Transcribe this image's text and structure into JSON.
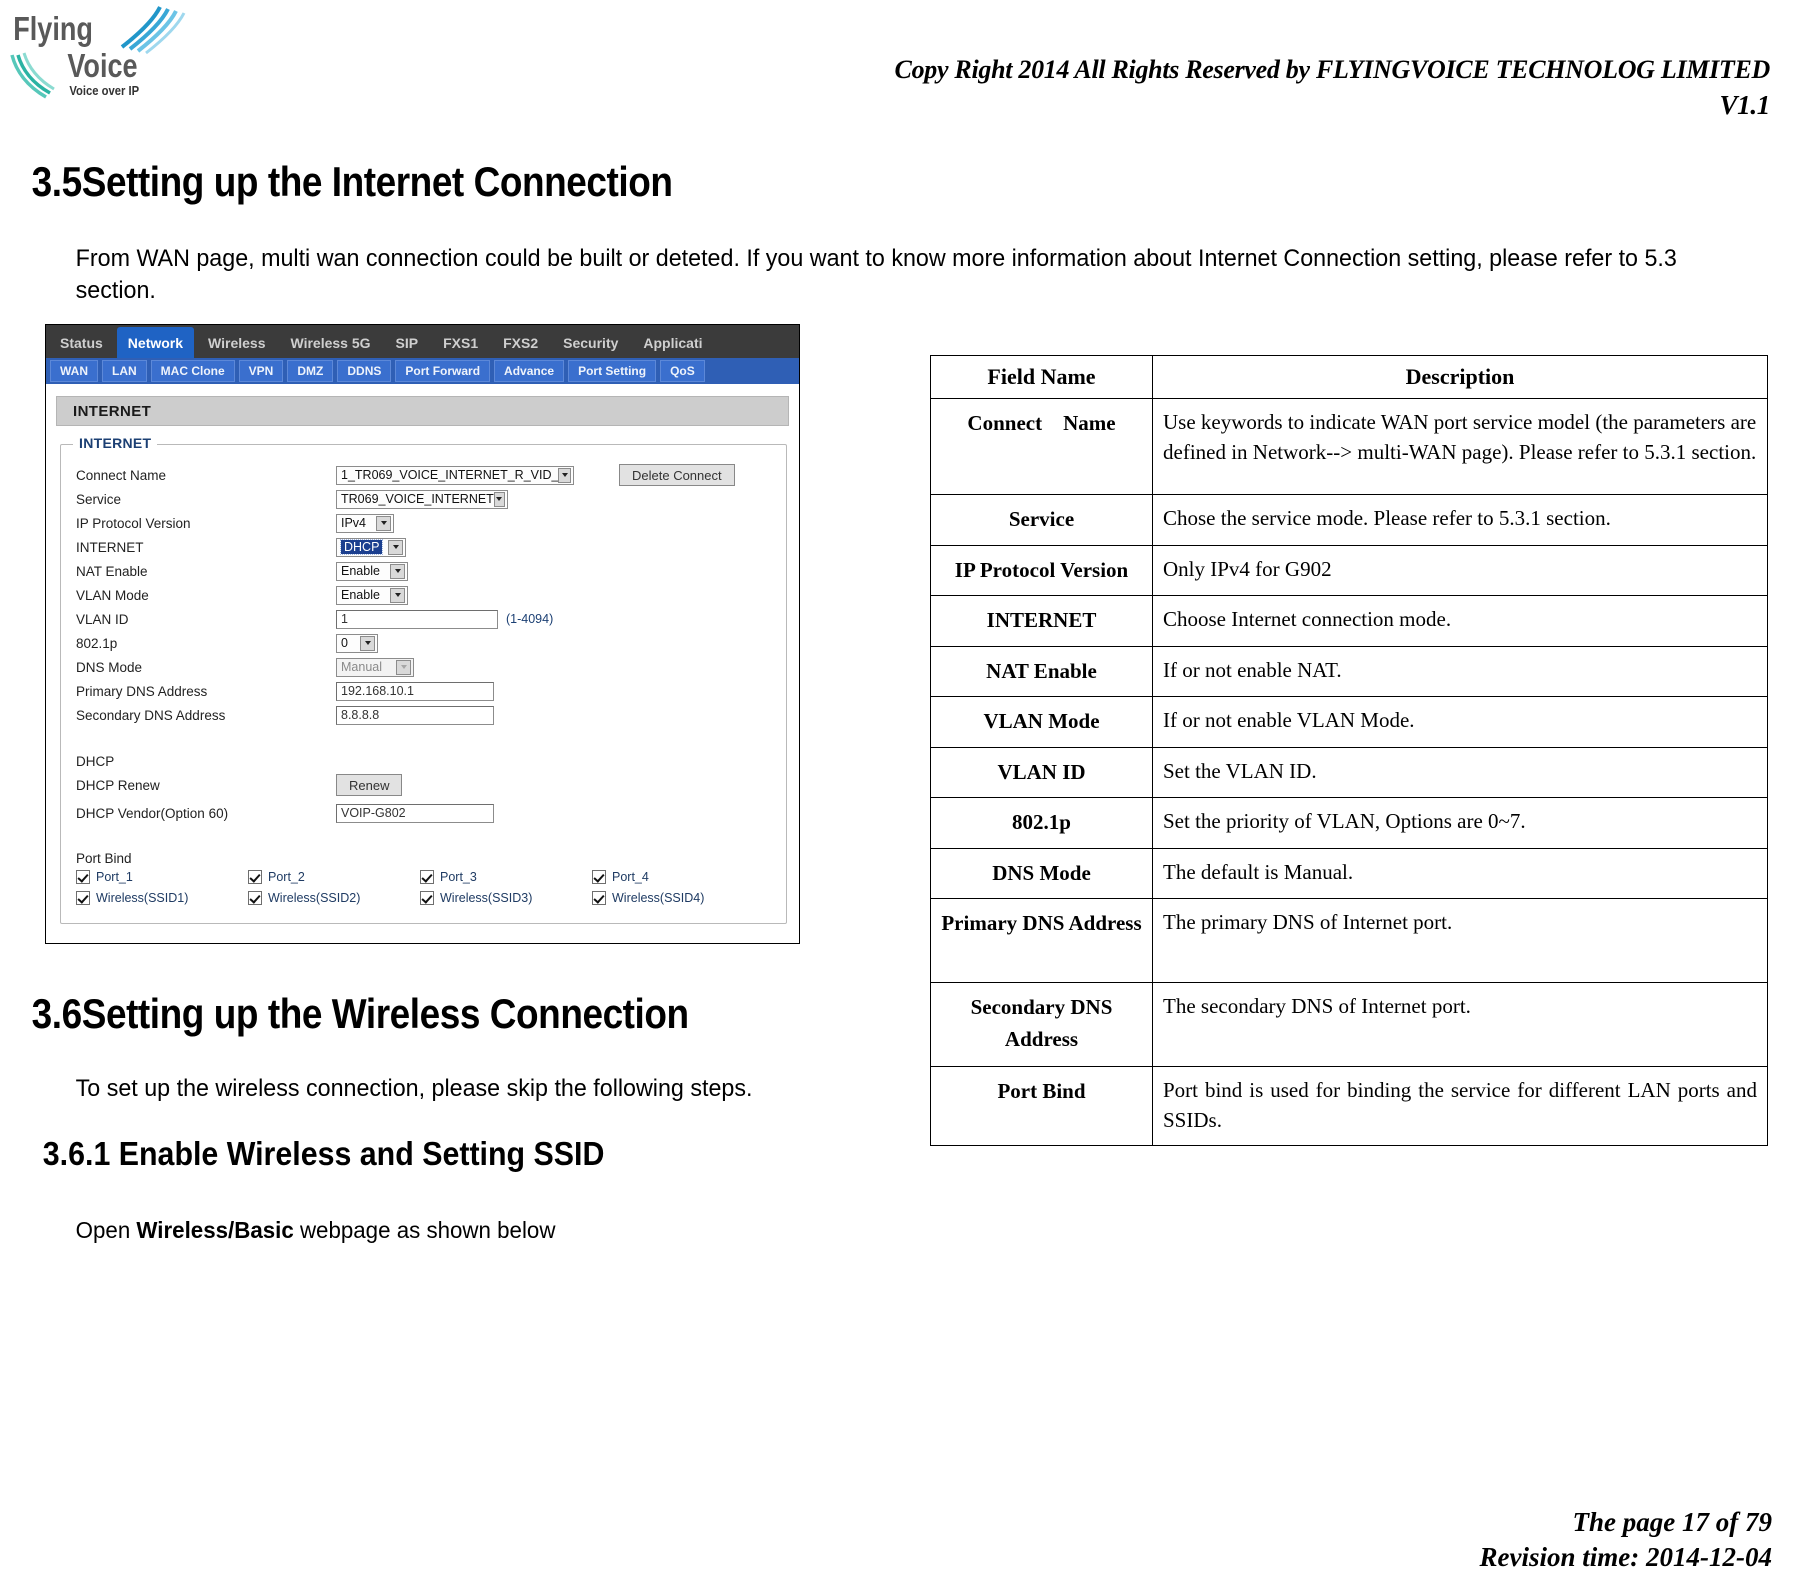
{
  "header": {
    "copyright": "Copy Right 2014 All Rights Reserved by FLYINGVOICE TECHNOLOG LIMITED",
    "version": "V1.1",
    "logo_line1": "Flying",
    "logo_line2": "Voice",
    "logo_tagline": "Voice over IP"
  },
  "sections": {
    "s35_title": "3.5Setting up the Internet Connection",
    "s35_para": "From WAN page, multi wan connection could be built or deteted. If you want to know more information about Internet Connection setting, please refer to 5.3 section.",
    "s36_title": "3.6Setting up the Wireless Connection",
    "s36_para": "To set up the wireless connection, please skip the following steps.",
    "s361_title": "3.6.1 Enable Wireless and Setting SSID",
    "s361_para_prefix": "Open ",
    "s361_para_bold": "Wireless/Basic",
    "s361_para_suffix": " webpage as shown below"
  },
  "router_ui": {
    "top_tabs": [
      {
        "label": "Status",
        "active": false
      },
      {
        "label": "Network",
        "active": true
      },
      {
        "label": "Wireless",
        "active": false
      },
      {
        "label": "Wireless 5G",
        "active": false
      },
      {
        "label": "SIP",
        "active": false
      },
      {
        "label": "FXS1",
        "active": false
      },
      {
        "label": "FXS2",
        "active": false
      },
      {
        "label": "Security",
        "active": false
      },
      {
        "label": "Applicati",
        "active": false
      }
    ],
    "sub_tabs": [
      {
        "label": "WAN"
      },
      {
        "label": "LAN"
      },
      {
        "label": "MAC Clone"
      },
      {
        "label": "VPN"
      },
      {
        "label": "DMZ"
      },
      {
        "label": "DDNS"
      },
      {
        "label": "Port Forward"
      },
      {
        "label": "Advance"
      },
      {
        "label": "Port Setting"
      },
      {
        "label": "QoS"
      }
    ],
    "panel_title": "INTERNET",
    "fieldset_legend": "INTERNET",
    "fields": {
      "connect_name_label": "Connect Name",
      "connect_name_value": "1_TR069_VOICE_INTERNET_R_VID_",
      "delete_connect_button": "Delete Connect",
      "service_label": "Service",
      "service_value": "TR069_VOICE_INTERNET",
      "ip_protocol_label": "IP Protocol Version",
      "ip_protocol_value": "IPv4",
      "internet_label": "INTERNET",
      "internet_value": "DHCP",
      "nat_enable_label": "NAT Enable",
      "nat_enable_value": "Enable",
      "vlan_mode_label": "VLAN Mode",
      "vlan_mode_value": "Enable",
      "vlan_id_label": "VLAN ID",
      "vlan_id_value": "1",
      "vlan_id_hint": "(1-4094)",
      "dot1p_label": "802.1p",
      "dot1p_value": "0",
      "dns_mode_label": "DNS Mode",
      "dns_mode_value": "Manual",
      "primary_dns_label": "Primary DNS Address",
      "primary_dns_value": "192.168.10.1",
      "secondary_dns_label": "Secondary DNS Address",
      "secondary_dns_value": "8.8.8.8",
      "dhcp_group_label": "DHCP",
      "dhcp_renew_label": "DHCP Renew",
      "dhcp_renew_button": "Renew",
      "dhcp_vendor_label": "DHCP Vendor(Option 60)",
      "dhcp_vendor_value": "VOIP-G802",
      "port_bind_label": "Port Bind"
    },
    "port_bind": [
      {
        "port": "Port_1",
        "wireless": "Wireless(SSID1)",
        "port_checked": true,
        "wireless_checked": true
      },
      {
        "port": "Port_2",
        "wireless": "Wireless(SSID2)",
        "port_checked": true,
        "wireless_checked": true
      },
      {
        "port": "Port_3",
        "wireless": "Wireless(SSID3)",
        "port_checked": true,
        "wireless_checked": true
      },
      {
        "port": "Port_4",
        "wireless": "Wireless(SSID4)",
        "port_checked": true,
        "wireless_checked": true
      }
    ]
  },
  "reference_table": {
    "columns": [
      "Field Name",
      "Description"
    ],
    "rows": [
      {
        "field": "Connect Name",
        "description": "Use keywords to indicate WAN port service model (the parameters are defined in Network--> multi-WAN page). Please refer to 5.3.1 section."
      },
      {
        "field": "Service",
        "description": "Chose the service mode. Please refer to 5.3.1 section."
      },
      {
        "field": "IP Protocol Version",
        "description": "Only IPv4 for G902"
      },
      {
        "field": "INTERNET",
        "description": "Choose Internet connection mode."
      },
      {
        "field": "NAT Enable",
        "description": "If or not enable NAT."
      },
      {
        "field": "VLAN Mode",
        "description": "If or not enable VLAN Mode."
      },
      {
        "field": "VLAN ID",
        "description": "Set the VLAN ID."
      },
      {
        "field": "802.1p",
        "description": "Set the priority of VLAN, Options are 0~7."
      },
      {
        "field": "DNS Mode",
        "description": "The default is Manual."
      },
      {
        "field": "Primary DNS Address",
        "description": "The primary DNS of Internet port."
      },
      {
        "field": "Secondary DNS Address",
        "description": "The secondary DNS of Internet port."
      },
      {
        "field": "Port Bind",
        "description": "Port bind is used for binding the service for different LAN ports and SSIDs."
      }
    ]
  },
  "footer": {
    "page": "The page 17 of 79",
    "revision": "Revision time: 2014-12-04"
  },
  "colors": {
    "nav_active": "#1f63c4",
    "nav_bg": "#3b3b3b",
    "sub_nav_bg": "#2f5fb5",
    "highlight": "#1b3f8f"
  }
}
